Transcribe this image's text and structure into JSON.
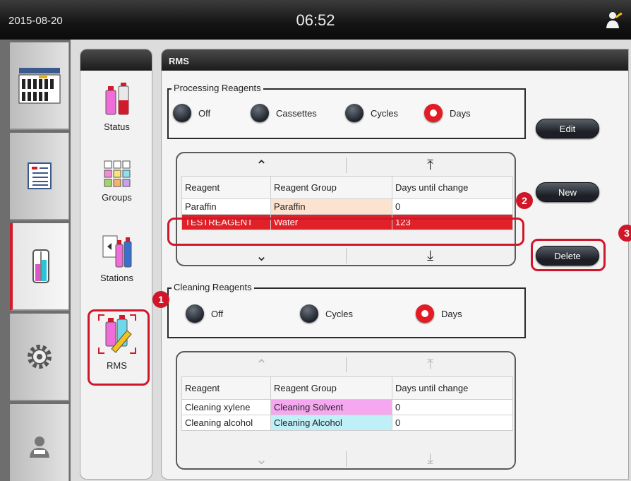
{
  "topbar": {
    "date": "2015-08-20",
    "time": "06:52"
  },
  "submenu": {
    "items": [
      {
        "label": "Status"
      },
      {
        "label": "Groups"
      },
      {
        "label": "Stations"
      },
      {
        "label": "RMS"
      }
    ]
  },
  "panel": {
    "title": "RMS",
    "processing": {
      "legend": "Processing Reagents",
      "options": [
        "Off",
        "Cassettes",
        "Cycles",
        "Days"
      ],
      "selected": "Days",
      "table": {
        "headers": [
          "Reagent",
          "Reagent Group",
          "Days until change"
        ],
        "rows": [
          [
            "Paraffin",
            "Paraffin",
            "0"
          ],
          [
            "TESTREAGENT",
            "Water",
            "123"
          ]
        ]
      }
    },
    "cleaning": {
      "legend": "Cleaning Reagents",
      "options": [
        "Off",
        "Cycles",
        "Days"
      ],
      "selected": "Days",
      "table": {
        "headers": [
          "Reagent",
          "Reagent Group",
          "Days until change"
        ],
        "rows": [
          [
            "Cleaning xylene",
            "Cleaning Solvent",
            "0"
          ],
          [
            "Cleaning alcohol",
            "Cleaning Alcohol",
            "0"
          ]
        ]
      }
    },
    "buttons": {
      "edit": "Edit",
      "new": "New",
      "delete": "Delete"
    }
  },
  "callouts": [
    "1",
    "2",
    "3"
  ],
  "colors": {
    "accent": "#d0172a",
    "selected_row": "#e02128",
    "paraffin_group": "#fbe3cf",
    "cleaning_solvent": "#f5a8f0",
    "cleaning_alcohol": "#bff0f7"
  },
  "icons": {
    "rail": [
      "programs-icon",
      "reagents-icon",
      "reagent-bottles-icon",
      "settings-gear-icon",
      "user-icon"
    ],
    "topbar_user": "user-key-icon"
  }
}
